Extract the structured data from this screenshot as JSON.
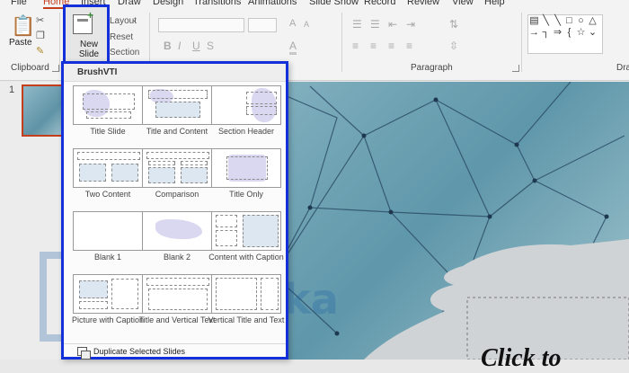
{
  "ribbon": {
    "tabs": [
      "File",
      "Home",
      "Insert",
      "Draw",
      "Design",
      "Transitions",
      "Animations",
      "Slide Show",
      "Record",
      "Review",
      "View",
      "Help"
    ],
    "clipboard": {
      "paste_label": "Paste",
      "group_label": "Clipboard"
    },
    "slides": {
      "new_slide_label": "New Slide",
      "layout_label": "Layout",
      "reset_label": "Reset",
      "section_label": "Section"
    },
    "font": {
      "bold": "B",
      "italic": "I",
      "underline": "U",
      "strike": "S",
      "size_up": "A",
      "size_down": "A",
      "clear": "A"
    },
    "paragraph": {
      "group_label": "Paragraph"
    },
    "drawing": {
      "group_label": "Drav"
    }
  },
  "slide_panel": {
    "slide_number": "1"
  },
  "slide": {
    "title_text": "Click to"
  },
  "watermark": {
    "text": "TeknEka"
  },
  "new_slide_menu": {
    "theme_name": "BrushVTI",
    "layouts": [
      {
        "label": "Title Slide"
      },
      {
        "label": "Title and Content"
      },
      {
        "label": "Section Header"
      },
      {
        "label": "Two Content"
      },
      {
        "label": "Comparison"
      },
      {
        "label": "Title Only"
      },
      {
        "label": "Blank 1"
      },
      {
        "label": "Blank 2"
      },
      {
        "label": "Content with Caption"
      },
      {
        "label": "Picture with Caption"
      },
      {
        "label": "Title and Vertical Text"
      },
      {
        "label": "Vertical Title and Text"
      }
    ],
    "footer_label": "Duplicate Selected Slides"
  },
  "colors": {
    "highlight": "#1430d8",
    "accent": "#c43e1c",
    "brush": "#d6d3ee",
    "slide_bg": "#76a8b8"
  }
}
